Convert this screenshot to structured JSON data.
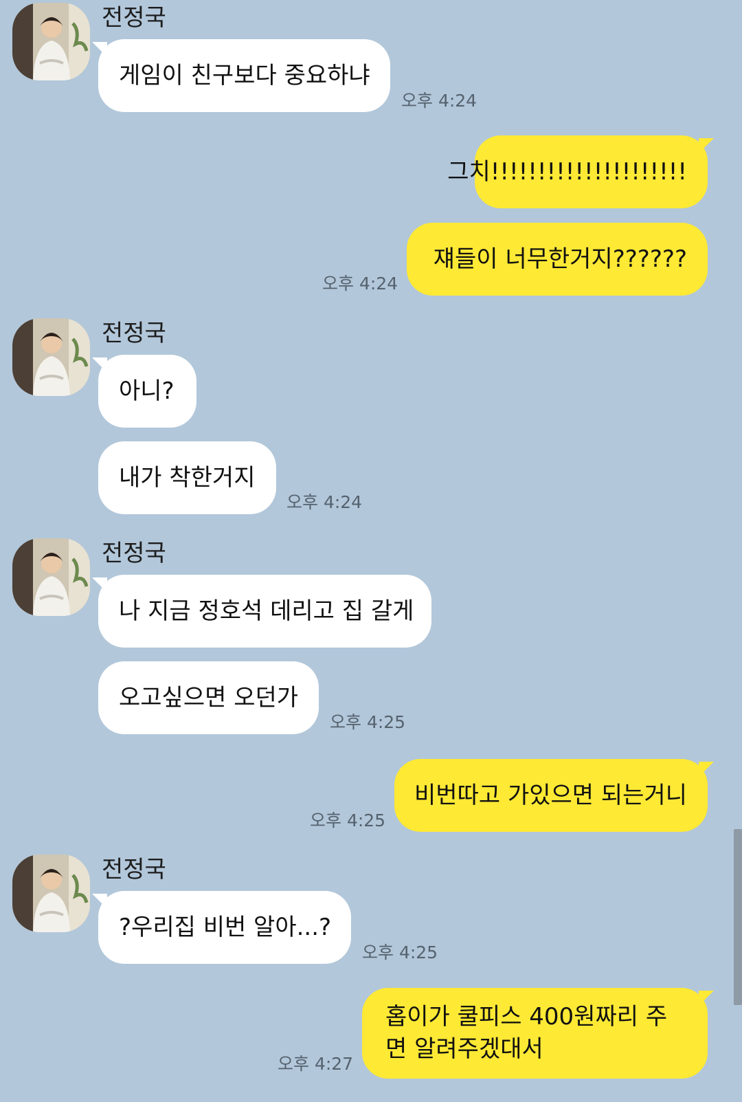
{
  "chat": {
    "colors": {
      "background": "#b2c7da",
      "my_bubble": "#fee934",
      "their_bubble": "#ffffff"
    },
    "sender_name": "전정국",
    "messages": [
      {
        "from": "them",
        "text": "게임이 친구보다 중요하냐",
        "time": "오후 4:24"
      },
      {
        "from": "me",
        "text": "그치!!!!!!!!!!!!!!!!!!!!!"
      },
      {
        "from": "me",
        "text": "쟤들이 너무한거지??????",
        "time": "오후 4:24"
      },
      {
        "from": "them",
        "text": "아니?"
      },
      {
        "from": "them",
        "text": "내가 착한거지",
        "time": "오후 4:24"
      },
      {
        "from": "them",
        "text": "나 지금 정호석 데리고 집 갈게"
      },
      {
        "from": "them",
        "text": "오고싶으면 오던가",
        "time": "오후 4:25"
      },
      {
        "from": "me",
        "text": "비번따고 가있으면 되는거니",
        "time": "오후 4:25"
      },
      {
        "from": "them",
        "text": "?우리집 비번 알아...?",
        "time": "오후 4:25"
      },
      {
        "from": "me",
        "text": "홉이가 쿨피스 400원짜리 주면 알려주겠대서",
        "time": "오후 4:27"
      }
    ]
  }
}
